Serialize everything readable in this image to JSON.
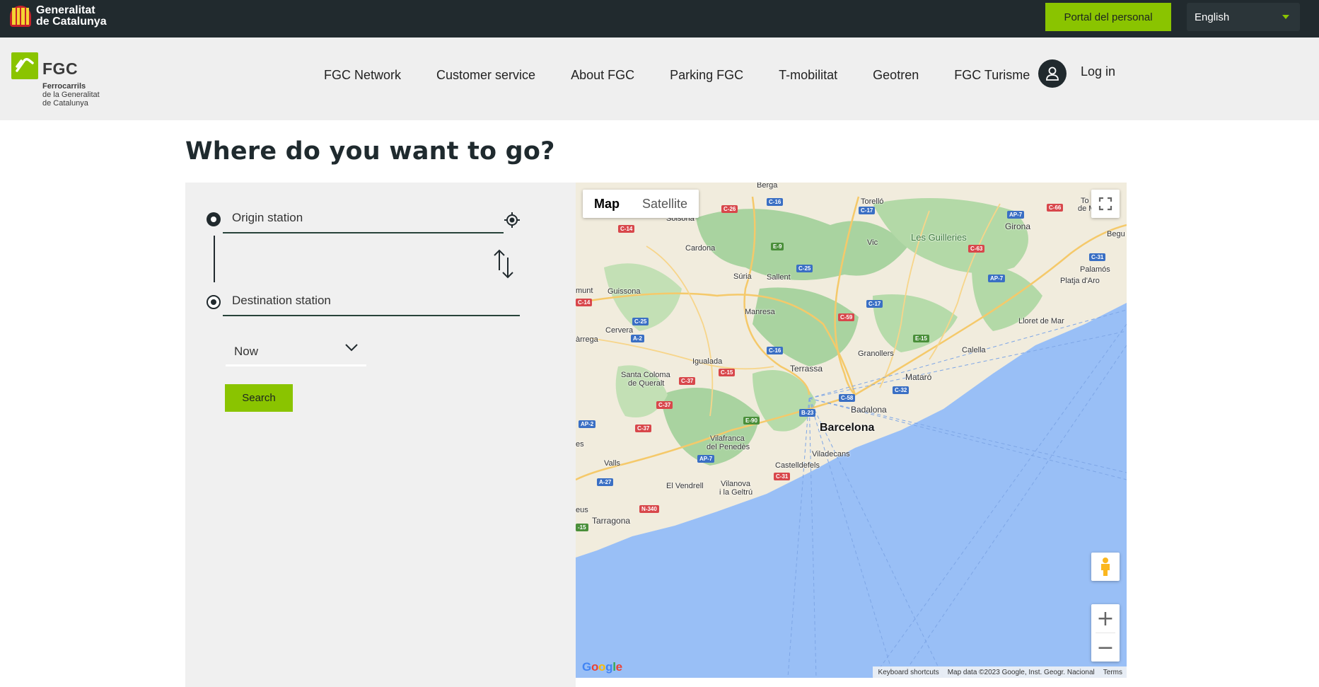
{
  "topbar": {
    "brand_line1": "Generalitat",
    "brand_line2": "de Catalunya",
    "portal_button": "Portal del personal",
    "language": "English"
  },
  "header": {
    "logo_name": "FGC",
    "logo_sub_bold": "Ferrocarrils",
    "logo_sub_line2": "de la Generalitat",
    "logo_sub_line3": "de Catalunya",
    "nav": [
      "FGC Network",
      "Customer service",
      "About FGC",
      "Parking FGC",
      "T-mobilitat",
      "Geotren",
      "FGC Turisme"
    ],
    "login_label": "Log in"
  },
  "page": {
    "title": "Where do you want to go?"
  },
  "route_form": {
    "origin_placeholder": "Origin station",
    "destination_placeholder": "Destination station",
    "when_value": "Now",
    "search_label": "Search"
  },
  "map": {
    "type_map": "Map",
    "type_satellite": "Satellite",
    "google_logo": "Google",
    "attribution": {
      "shortcuts": "Keyboard shortcuts",
      "data": "Map data ©2023 Google, Inst. Geogr. Nacional",
      "terms": "Terms"
    },
    "places": {
      "barcelona": "Barcelona",
      "berga": "Berga",
      "solsona": "Solsona",
      "torello": "Torelló",
      "girona": "Girona",
      "cardona": "Cardona",
      "vic": "Vic",
      "les_guilleries": "Les Guilleries",
      "begur": "Begu",
      "suria": "Súria",
      "sallent": "Sallent",
      "palamos": "Palamós",
      "platja": "Platja d'Aro",
      "guissona": "Guissona",
      "manresa": "Manresa",
      "lloret": "Lloret de Mar",
      "cervera": "Cervera",
      "igualada": "Igualada",
      "granollers": "Granollers",
      "calella": "Calella",
      "terrassa": "Terrassa",
      "santa_coloma": "Santa Coloma",
      "santa_coloma_2": "de Queralt",
      "mataro": "Mataró",
      "badalona": "Badalona",
      "vilafranca": "Vilafranca",
      "vilafranca_2": "del Penedès",
      "viladecans": "Viladecans",
      "castelldefels": "Castelldefels",
      "valls": "Valls",
      "el_vendrell": "El Vendrell",
      "vilanova": "Vilanova",
      "vilanova_2": "i la Geltrú",
      "tarragona": "Tarragona",
      "to_de": "To",
      "to_de_2": "de M",
      "munt": "munt",
      "arrega": "àrrega",
      "eus": "eus",
      "es": "es"
    }
  }
}
